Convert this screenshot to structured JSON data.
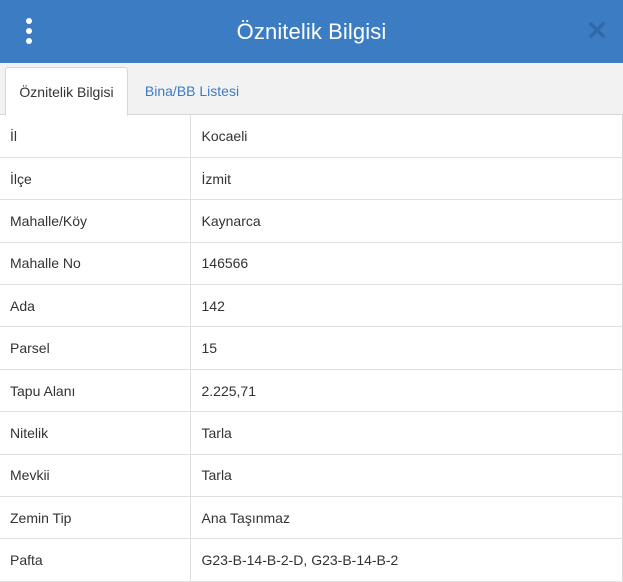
{
  "header": {
    "title": "Öznitelik Bilgisi",
    "menu_icon": "vertical-dots-icon",
    "close_icon": "close-icon",
    "bg_color": "#3b7cc2"
  },
  "tabs": [
    {
      "label": "Öznitelik Bilgisi",
      "active": true
    },
    {
      "label": "Bina/BB Listesi",
      "active": false
    }
  ],
  "rows": [
    {
      "key": "İl",
      "value": "Kocaeli"
    },
    {
      "key": "İlçe",
      "value": "İzmit"
    },
    {
      "key": "Mahalle/Köy",
      "value": "Kaynarca"
    },
    {
      "key": "Mahalle No",
      "value": "146566"
    },
    {
      "key": "Ada",
      "value": "142"
    },
    {
      "key": "Parsel",
      "value": "15"
    },
    {
      "key": "Tapu Alanı",
      "value": "2.225,71"
    },
    {
      "key": "Nitelik",
      "value": "Tarla"
    },
    {
      "key": "Mevkii",
      "value": "Tarla"
    },
    {
      "key": "Zemin Tip",
      "value": "Ana Taşınmaz"
    },
    {
      "key": "Pafta",
      "value": "G23-B-14-B-2-D, G23-B-14-B-2"
    }
  ]
}
